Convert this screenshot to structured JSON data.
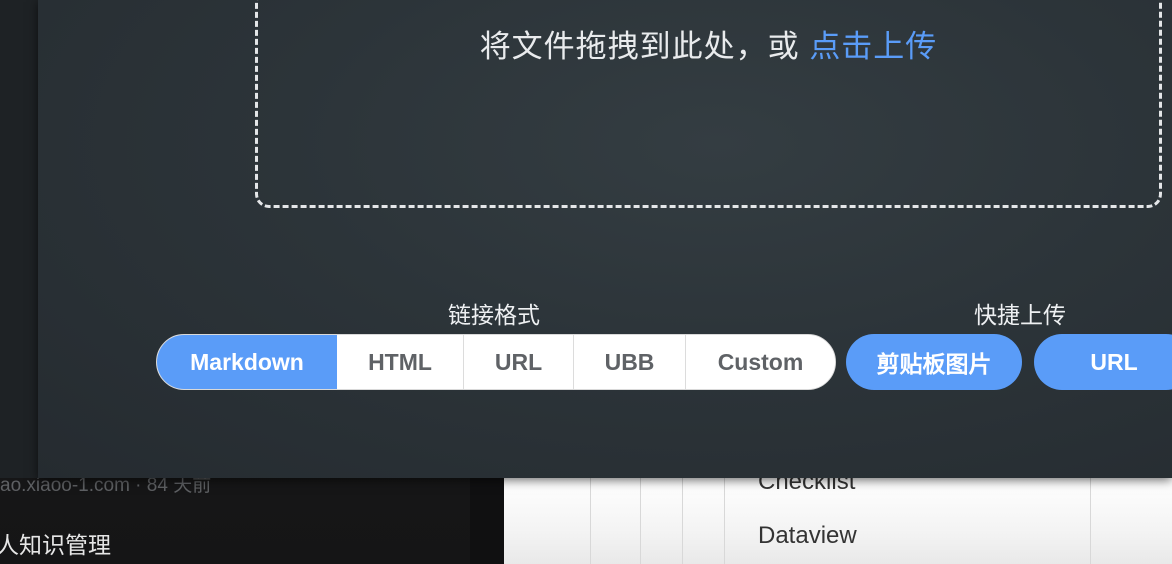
{
  "background": {
    "left_meta": "ao.xiaoo-1.com · 84 天前",
    "left_item": "人知识管理",
    "right_rows": [
      "Checklist",
      "Dataview"
    ]
  },
  "upload": {
    "drop_text": "将文件拖拽到此处，或 ",
    "drop_link": "点击上传",
    "format_label": "链接格式",
    "formats": [
      "Markdown",
      "HTML",
      "URL",
      "UBB",
      "Custom"
    ],
    "active_format": "Markdown",
    "quick_label": "快捷上传",
    "quick_buttons": [
      "剪贴板图片",
      "URL"
    ]
  },
  "colors": {
    "accent": "#5a9cf8",
    "panel": "#2c3439"
  }
}
